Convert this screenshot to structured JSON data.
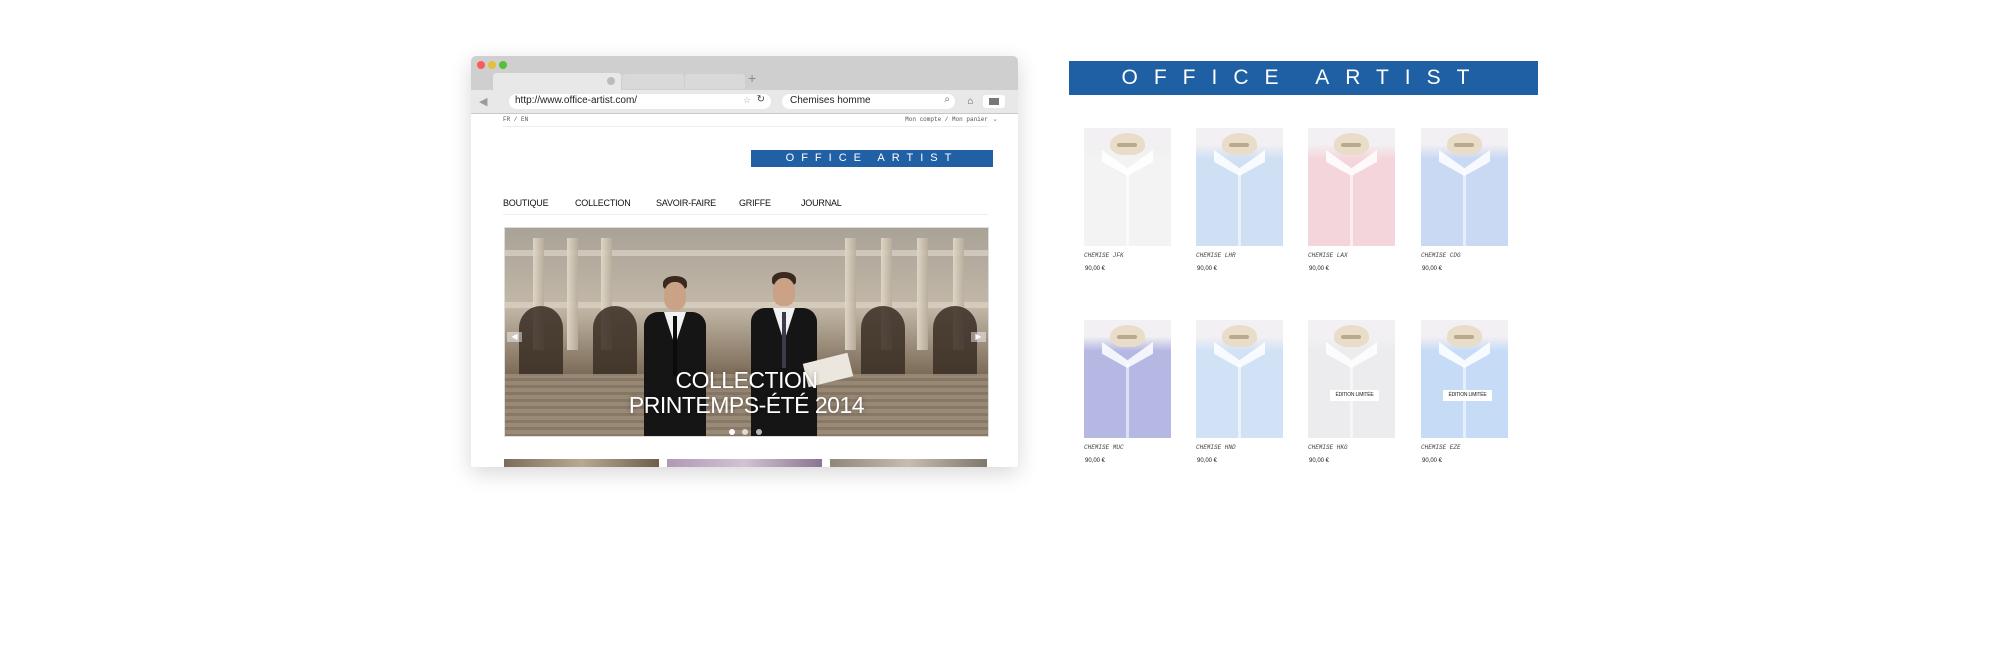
{
  "browser": {
    "url": "http://www.office-artist.com/",
    "search_value": "Chemises homme",
    "new_tab": "+"
  },
  "site": {
    "lang": "FR / EN",
    "account": "Mon compte / Mon panier",
    "logo": "OFFICE ARTIST",
    "nav": [
      "BOUTIQUE",
      "COLLECTION",
      "SAVOIR-FAIRE",
      "GRIFFE",
      "JOURNAL"
    ],
    "hero": {
      "line1": "COLLECTION",
      "line2": "PRINTEMPS-ÉTÉ 2014",
      "prev": "◀",
      "next": "▶"
    }
  },
  "catalog": {
    "banner": "OFFICE ARTIST",
    "products": [
      {
        "name": "CHEMISE JFK",
        "price": "90,00 €",
        "color": "#f3f3f3",
        "limited": ""
      },
      {
        "name": "CHEMISE LHR",
        "price": "90,00 €",
        "color": "#cfe0f5",
        "limited": ""
      },
      {
        "name": "CHEMISE LAX",
        "price": "90,00 €",
        "color": "#f5d5dc",
        "limited": ""
      },
      {
        "name": "CHEMISE CDG",
        "price": "90,00 €",
        "color": "#c9d8f3",
        "limited": ""
      },
      {
        "name": "CHEMISE MUC",
        "price": "90,00 €",
        "color": "#b6b8e4",
        "limited": ""
      },
      {
        "name": "CHEMISE HND",
        "price": "90,00 €",
        "color": "#d2e2f6",
        "limited": ""
      },
      {
        "name": "CHEMISE HKG",
        "price": "90,00 €",
        "color": "#ececef",
        "limited": "ÉDITION LIMITÉE"
      },
      {
        "name": "CHEMISE EZE",
        "price": "90,00 €",
        "color": "#c6dcf6",
        "limited": "ÉDITION LIMITÉE"
      }
    ]
  },
  "colors": {
    "brand_blue": "#1f5fa3"
  }
}
